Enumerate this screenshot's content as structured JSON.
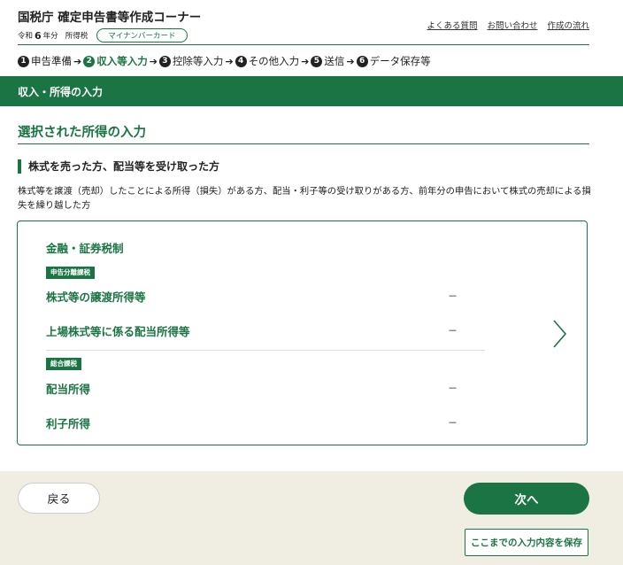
{
  "header": {
    "title": "国税庁 確定申告書等作成コーナー",
    "era": "令和",
    "year": "6",
    "year_suffix": "年分",
    "tax_type": "所得税",
    "mynumber_badge": "マイナンバーカード",
    "links": [
      "よくある質問",
      "お問い合わせ",
      "作成の流れ"
    ]
  },
  "steps": [
    {
      "num": "1",
      "label": "申告準備",
      "active": false
    },
    {
      "num": "2",
      "label": "収入等入力",
      "active": true
    },
    {
      "num": "3",
      "label": "控除等入力",
      "active": false
    },
    {
      "num": "4",
      "label": "その他入力",
      "active": false
    },
    {
      "num": "5",
      "label": "送信",
      "active": false
    },
    {
      "num": "6",
      "label": "データ保存等",
      "active": false
    }
  ],
  "step_arrow": "➔",
  "band": {
    "title": "収入・所得の入力"
  },
  "section": {
    "title": "選択された所得の入力",
    "subtitle": "株式を売った方、配当等を受け取った方",
    "description": "株式等を譲渡（売却）したことによる所得（損失）がある方、配当・利子等の受け取りがある方、前年分の申告において株式の売却による損失を繰り越した方"
  },
  "card": {
    "group_title": "金融・証券税制",
    "tag_separate": "申告分離課税",
    "tag_aggregate": "総合課税",
    "rows": [
      {
        "label": "株式等の譲渡所得等",
        "value": "－"
      },
      {
        "label": "上場株式等に係る配当所得等",
        "value": "－"
      },
      {
        "label": "配当所得",
        "value": "－"
      },
      {
        "label": "利子所得",
        "value": "－"
      }
    ]
  },
  "footer": {
    "back": "戻る",
    "next": "次へ",
    "save": "ここまでの入力内容を保存"
  },
  "colors": {
    "accent": "#1b7443",
    "footer_bg": "#f0ede3"
  }
}
